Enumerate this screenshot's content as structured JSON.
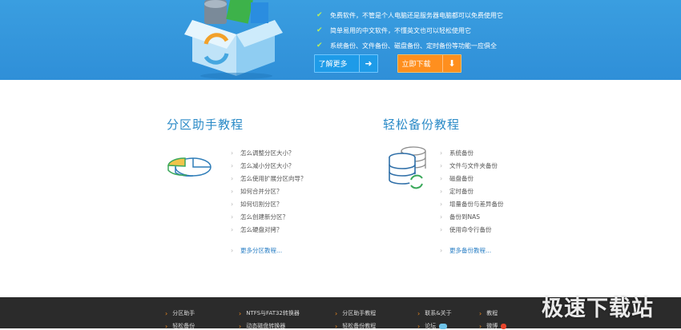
{
  "banner": {
    "features": [
      "免费软件，不管是个人电脑还是服务器电脑都可以免费使用它",
      "简单易用的中文软件，不懂英文也可以轻松使用它",
      "系统备份、文件备份、磁盘备份、定时备份等功能一应俱全"
    ],
    "learn_more": "了解更多",
    "download": "立即下载"
  },
  "partition": {
    "title": "分区助手教程",
    "items": [
      "怎么调整分区大小？",
      "怎么减小分区大小？",
      "怎么使用扩展分区向导？",
      "如何合并分区？",
      "如何切割分区？",
      "怎么创建新分区？",
      "怎么硬盘对拷？"
    ],
    "more": "更多分区教程..."
  },
  "backup": {
    "title": "轻松备份教程",
    "items": [
      "系统备份",
      "文件与文件夹备份",
      "磁盘备份",
      "定时备份",
      "增量备份与差异备份",
      "备份到NAS",
      "使用命令行备份"
    ],
    "more": "更多备份教程..."
  },
  "footer": {
    "row1": [
      "分区助手",
      "NTFS与FAT32转换器",
      "分区助手教程",
      "联系&关于",
      "教程"
    ],
    "row2": [
      "轻松备份",
      "动态磁盘转换器",
      "轻松备份教程",
      "论坛",
      "微博"
    ]
  },
  "watermark": "极速下载站",
  "colors": {
    "banner": "#2f8fd8",
    "accent_blue": "#2a8ac7",
    "download_orange": "#ff8f1e",
    "footer_bg": "#2b2b2b",
    "footer_chevron": "#f08a1c"
  },
  "icons": [
    "check-icon",
    "arrow-right-icon",
    "arrow-down-icon",
    "chevron-right-icon",
    "pie-chart-icon",
    "database-sync-icon",
    "software-box-icon",
    "chat-bubble-icon",
    "weibo-icon"
  ]
}
